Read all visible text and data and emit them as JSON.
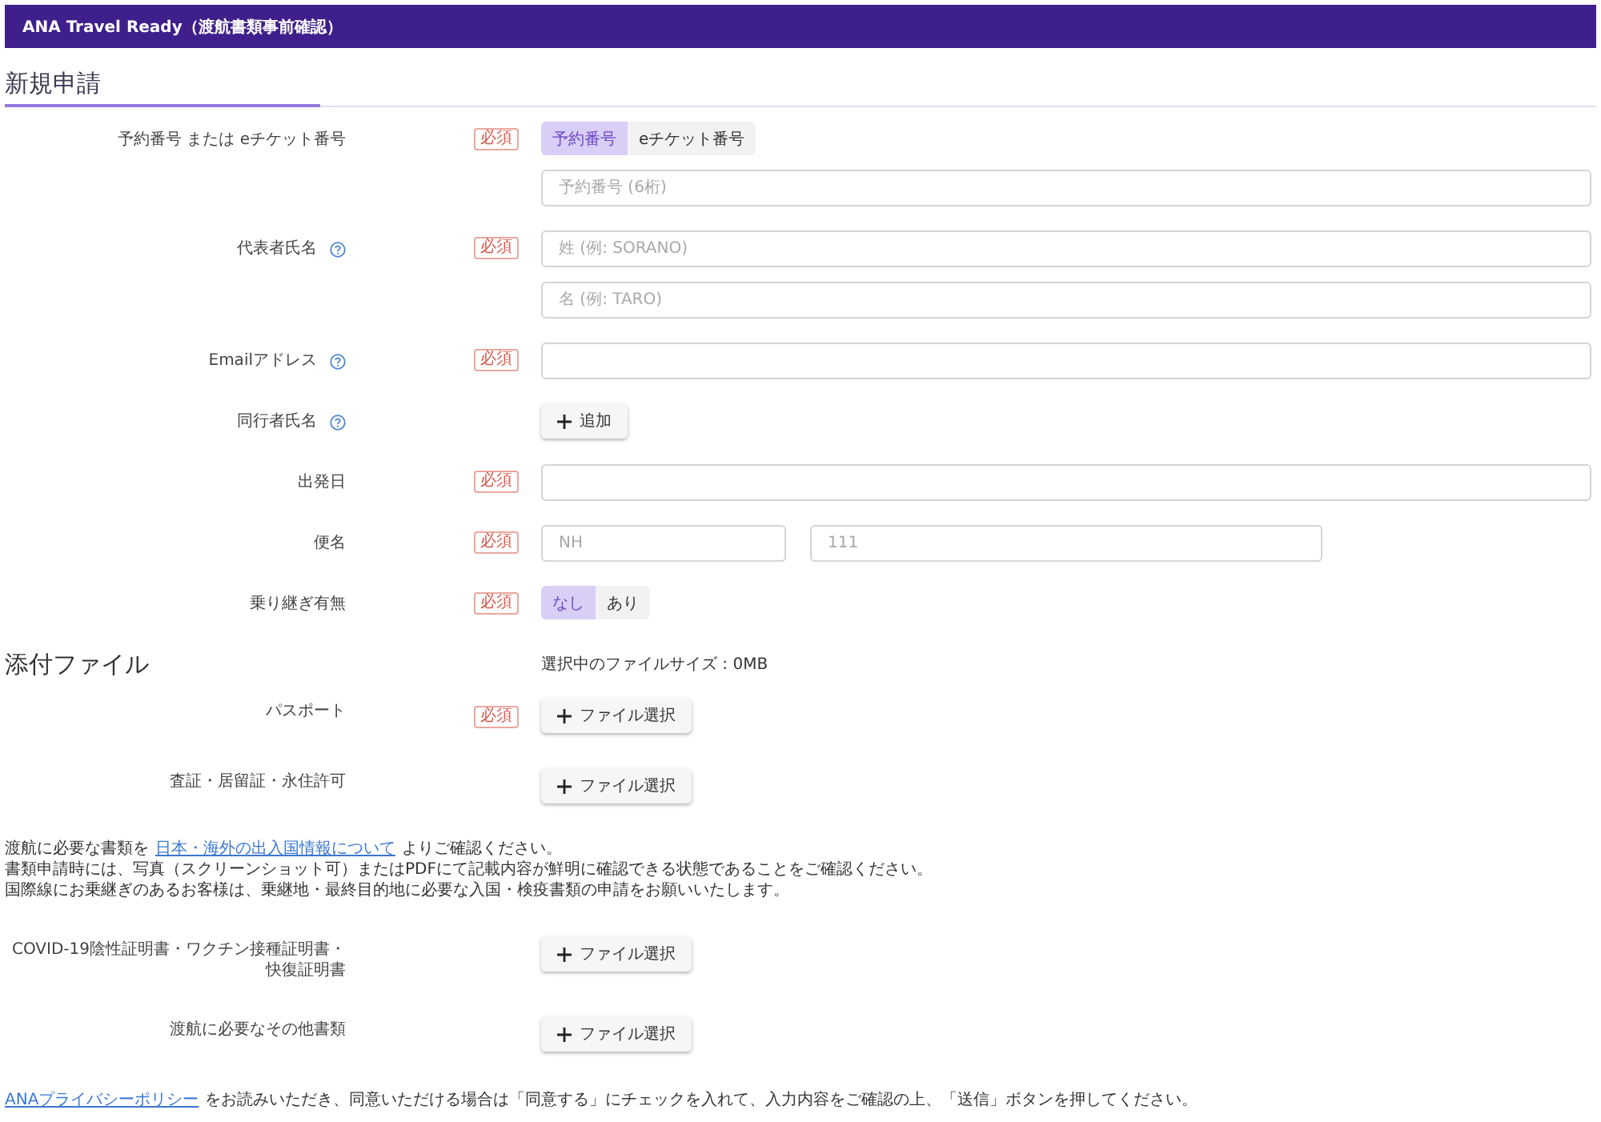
{
  "header": {
    "title": "ANA Travel Ready（渡航書類事前確認）"
  },
  "application": {
    "heading": "新規申請",
    "fields": [
      {
        "label": "予約番号 または eチケット番号",
        "help": false,
        "badge": "必須",
        "controls": [
          {
            "kind": "segmented",
            "options": [
              {
                "label": "予約番号",
                "selected": true
              },
              {
                "label": "eチケット番号",
                "selected": false
              }
            ]
          },
          {
            "kind": "input",
            "placeholder": "予約番号 (6桁)"
          }
        ]
      },
      {
        "label": "代表者氏名",
        "help": true,
        "badge": "必須",
        "controls": [
          {
            "kind": "input",
            "placeholder": "姓 (例: SORANO)"
          },
          {
            "kind": "input",
            "placeholder": "名 (例: TARO)"
          }
        ]
      },
      {
        "label": "Emailアドレス",
        "help": true,
        "badge": "必須",
        "controls": [
          {
            "kind": "input"
          }
        ]
      },
      {
        "label": "同行者氏名",
        "help": true,
        "controls": [
          {
            "kind": "button",
            "label": "追加"
          }
        ]
      },
      {
        "label": "出発日",
        "help": false,
        "badge": "必須",
        "controls": [
          {
            "kind": "input"
          }
        ]
      },
      {
        "label": "便名",
        "help": false,
        "badge": "必須",
        "controls": [
          {
            "kind": "input_group",
            "inputs": [
              {
                "placeholder": "NH"
              },
              {
                "placeholder": "111"
              }
            ]
          }
        ]
      },
      {
        "label": "乗り継ぎ有無",
        "help": false,
        "badge": "必須",
        "controls": [
          {
            "kind": "segmented",
            "options": [
              {
                "label": "なし",
                "selected": true
              },
              {
                "label": "あり",
                "selected": false
              }
            ]
          }
        ]
      }
    ]
  },
  "attachments": {
    "heading": "添付ファイル",
    "file_size": "選択中のファイルサイズ : 0MB",
    "blocks": [
      {
        "kind": "file",
        "label": "パスポート",
        "badge": "必須",
        "button": "ファイル選択"
      },
      {
        "kind": "file",
        "label": "査証・居留証・永住許可",
        "button": "ファイル選択"
      },
      {
        "kind": "notice",
        "lines": [
          {
            "parts": [
              {
                "kind": "text",
                "text": "渡航に必要な書類を"
              },
              {
                "kind": "link",
                "text": "日本・海外の出入国情報について"
              },
              {
                "kind": "text",
                "text": "よりご確認ください。"
              }
            ]
          },
          {
            "parts": [
              {
                "kind": "text",
                "text": "書類申請時には、写真（スクリーンショット可）またはPDFにて記載内容が鮮明に確認できる状態であることをご確認ください。"
              }
            ]
          },
          {
            "parts": [
              {
                "kind": "text",
                "text": "国際線にお乗継ぎのあるお客様は、乗継地・最終目的地に必要な入国・検疫書類の申請をお願いいたします。"
              }
            ]
          }
        ]
      },
      {
        "kind": "file",
        "label": "COVID-19陰性証明書・ワクチン接種証明書・快復証明書",
        "button": "ファイル選択"
      },
      {
        "kind": "file",
        "label": "渡航に必要なその他書類",
        "button": "ファイル選択"
      }
    ]
  },
  "consent": {
    "parts": [
      {
        "kind": "link",
        "text": "ANAプライバシーポリシー"
      },
      {
        "kind": "text",
        "text": "をお読みいただき、同意いただける場合は「同意する」にチェックを入れて、入力内容をご確認の上、「送信」ボタンを押してください。"
      }
    ]
  }
}
